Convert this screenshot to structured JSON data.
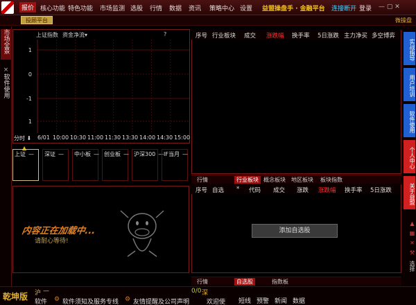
{
  "menubar": {
    "items": [
      {
        "label": "报价",
        "active": true
      },
      {
        "label": "核心功能"
      },
      {
        "label": "特色功能"
      },
      {
        "label": "市场监测"
      },
      {
        "label": "选股"
      },
      {
        "label": "行情"
      },
      {
        "label": "数据"
      },
      {
        "label": "资讯"
      },
      {
        "label": "策略中心"
      },
      {
        "label": "设置"
      }
    ],
    "brand": "益盟操盘手 · 金融平台",
    "connection": "连接断开",
    "login": "登录"
  },
  "subbar": {
    "tab": "投顾平台",
    "right": "微操盘"
  },
  "left_tabs": [
    "市场全景",
    "软件使用"
  ],
  "right_tabs": [
    {
      "label": "实战指导",
      "color": "#2060d0"
    },
    {
      "label": "用户培训",
      "color": "#2060d0"
    },
    {
      "label": "软件使用",
      "color": "#2060d0"
    },
    {
      "label": "个人中心",
      "color": "#d02020"
    },
    {
      "label": "关于益盟",
      "color": "#d02020"
    }
  ],
  "right_icons": [
    "arrow-up-icon",
    "chart-icon",
    "close-x-icon",
    "tool-icon"
  ],
  "right_icon_label": "选择",
  "chart": {
    "header_left": "上证指数",
    "header_mid": "资金净流▾",
    "help": "?",
    "y_ticks": [
      "1",
      "0",
      "-1",
      "1"
    ],
    "x_label": "分时",
    "date": "6/01",
    "x_ticks": [
      "10:00",
      "10:30",
      "11:00",
      "11:30",
      "13:30",
      "14:00",
      "14:30",
      "15:00"
    ]
  },
  "index_boxes": [
    {
      "name": "上证",
      "dash": "—",
      "selected": true
    },
    {
      "name": "深证",
      "dash": "—"
    },
    {
      "name": "中小板",
      "dash": "—"
    },
    {
      "name": "创业板",
      "dash": "—"
    },
    {
      "name": "沪深300",
      "dash": "—"
    },
    {
      "name": "IF当月",
      "dash": "—"
    }
  ],
  "loading": {
    "title": "内容正在加载中...",
    "subtitle": "请耐心等待!"
  },
  "table1": {
    "headers": [
      "序号",
      "行业板块",
      "成交",
      "涨跌幅",
      "换手率",
      "5日涨跌",
      "主力净买",
      "多空博弈"
    ],
    "accent": "#ff3030"
  },
  "tabstrip1": {
    "tabs": [
      "行情",
      "行业板块",
      "概念板块",
      "地区板块",
      "板块指数"
    ],
    "active_index": 1
  },
  "table2": {
    "headers": [
      "序号",
      "自选",
      "*",
      "代码",
      "成交",
      "涨跌",
      "涨跌幅",
      "换手率",
      "5日涨跌"
    ],
    "add_button": "添加自选股"
  },
  "tabstrip2": {
    "tabs": [
      "行情",
      "自选股",
      "指数板"
    ],
    "active_index": 1
  },
  "statusbar": {
    "brand": "乾坤版",
    "sh_label": "沪",
    "sh_value": "—",
    "sz_label": "深",
    "sz_value": "0/0",
    "items": [
      "软件",
      "软件须知及服务专线",
      "友情提醒及公司声明",
      "欢迎使"
    ],
    "tools": [
      "短线",
      "预警",
      "新闻",
      "数据"
    ]
  }
}
